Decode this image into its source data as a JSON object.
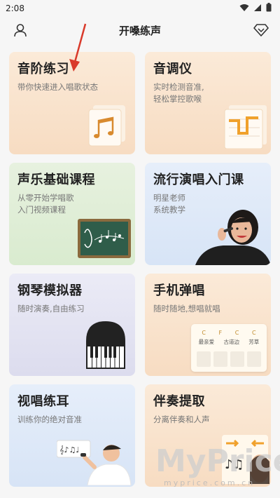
{
  "status": {
    "time": "2:08"
  },
  "header": {
    "title": "开嗓练声"
  },
  "cards": [
    {
      "title": "音阶练习",
      "subtitle": "带你快速进入唱歌状态"
    },
    {
      "title": "音调仪",
      "subtitle_line1": "实时检测音准,",
      "subtitle_line2": "轻松掌控歌喉"
    },
    {
      "title": "声乐基础课程",
      "subtitle_line1": "从零开始学唱歌",
      "subtitle_line2": "入门视频课程"
    },
    {
      "title": "流行演唱入门课",
      "subtitle_line1": "明星老师",
      "subtitle_line2": "系统教学"
    },
    {
      "title": "钢琴模拟器",
      "subtitle": "随时演奏,自由练习"
    },
    {
      "title": "手机弹唱",
      "subtitle": "随时随地,想唱就唱"
    },
    {
      "title": "视唱练耳",
      "subtitle": "训练你的绝对音准"
    },
    {
      "title": "伴奏提取",
      "subtitle": "分离伴奏和人声"
    }
  ],
  "chord_sheet": {
    "chords": [
      "C",
      "F",
      "C",
      "C"
    ],
    "lyrics": [
      "最亲爱",
      "古道边",
      "芳草"
    ]
  },
  "watermark": {
    "main": "MyPrice",
    "sub": "myprice.com.cn"
  },
  "colors": {
    "accent_red": "#d93a2b",
    "warm_card": "#f8e2cc",
    "green_card": "#e0eed7",
    "blue_card": "#dfe9f8",
    "purple_card": "#e4e4f2"
  },
  "icons": [
    "person-icon",
    "diamond-vip-icon",
    "wifi-icon",
    "signal-icon",
    "battery-icon"
  ]
}
